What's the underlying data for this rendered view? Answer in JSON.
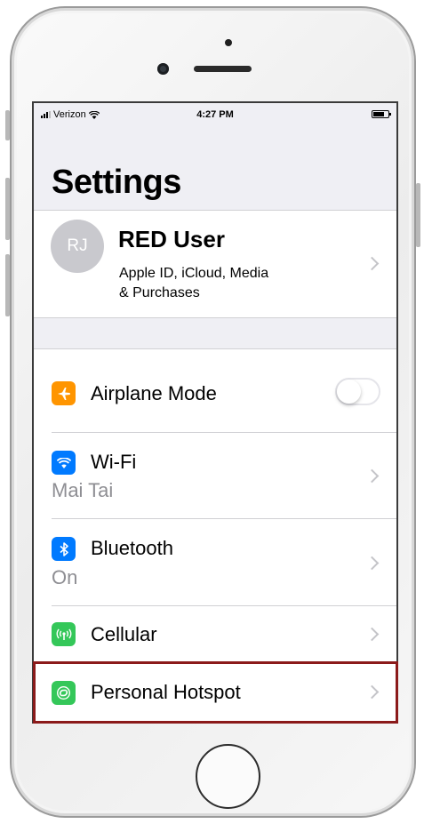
{
  "status_bar": {
    "carrier": "Verizon",
    "time": "4:27 PM"
  },
  "title": "Settings",
  "profile": {
    "initials": "RJ",
    "name": "RED User",
    "subtitle_line1": "Apple ID, iCloud, Media",
    "subtitle_line2": "& Purchases"
  },
  "rows": [
    {
      "label": "Airplane Mode",
      "icon": "airplane-icon",
      "icon_color": "#ff9500",
      "toggle_on": false
    },
    {
      "label": "Wi-Fi",
      "detail": "Mai Tai",
      "icon": "wifi-icon",
      "icon_color": "#007aff"
    },
    {
      "label": "Bluetooth",
      "detail": "On",
      "icon": "bluetooth-icon",
      "icon_color": "#007aff"
    },
    {
      "label": "Cellular",
      "icon": "cellular-icon",
      "icon_color": "#34c759"
    },
    {
      "label": "Personal Hotspot",
      "icon": "hotspot-icon",
      "icon_color": "#34c759"
    }
  ],
  "highlight_color": "#8b1a1a"
}
